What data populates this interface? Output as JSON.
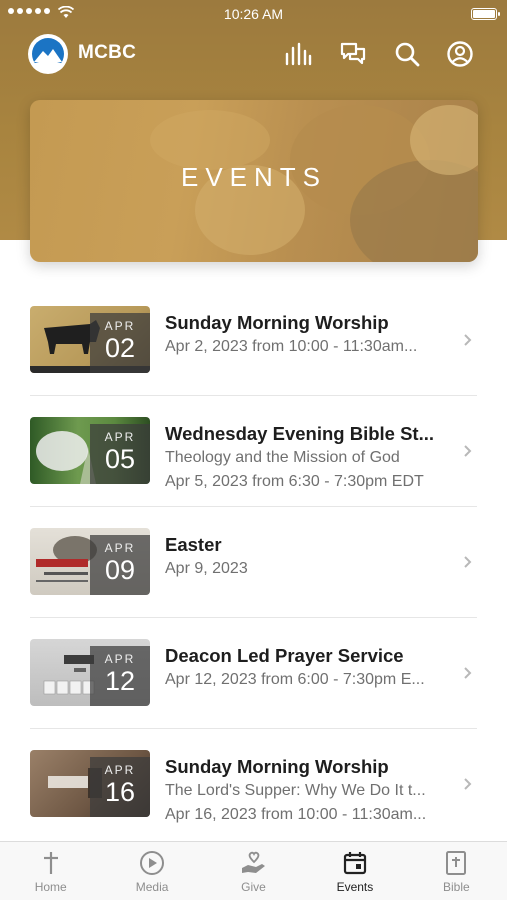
{
  "status_bar": {
    "time": "10:26 AM"
  },
  "app": {
    "title": "MCBC"
  },
  "hero": {
    "title": "EVENTS"
  },
  "events": [
    {
      "month": "APR",
      "day": "02",
      "title": "Sunday Morning Worship",
      "lines": [
        "Apr 2, 2023 from 10:00 - 11:30am..."
      ],
      "thumb_colors": [
        "#b89a5a",
        "#2a2a2a"
      ]
    },
    {
      "month": "APR",
      "day": "05",
      "title": "Wednesday Evening Bible St...",
      "lines": [
        "Theology and the Mission of God",
        "Apr 5, 2023 from 6:30 - 7:30pm EDT"
      ],
      "thumb_colors": [
        "#3d6b2f",
        "#8fb06a"
      ]
    },
    {
      "month": "APR",
      "day": "09",
      "title": "Easter",
      "lines": [
        "Apr 9, 2023"
      ],
      "thumb_colors": [
        "#d8d4cc",
        "#b03030"
      ]
    },
    {
      "month": "APR",
      "day": "12",
      "title": "Deacon Led Prayer Service",
      "lines": [
        "Apr 12, 2023 from 6:00 - 7:30pm E..."
      ],
      "thumb_colors": [
        "#c9c9c9",
        "#8a8a8a"
      ]
    },
    {
      "month": "APR",
      "day": "16",
      "title": "Sunday Morning Worship",
      "lines": [
        "The Lord's Supper: Why We Do It t...",
        "Apr 16, 2023 from 10:00 - 11:30am..."
      ],
      "thumb_colors": [
        "#7a6450",
        "#3a2e24"
      ]
    }
  ],
  "tabs": [
    {
      "label": "Home",
      "icon": "cross-icon"
    },
    {
      "label": "Media",
      "icon": "play-icon"
    },
    {
      "label": "Give",
      "icon": "giving-hand-icon"
    },
    {
      "label": "Events",
      "icon": "calendar-icon",
      "active": true
    },
    {
      "label": "Bible",
      "icon": "bible-icon"
    }
  ],
  "colors": {
    "header": "#a8843f",
    "active_tab": "#222222",
    "inactive_tab": "#8e8e8e"
  }
}
